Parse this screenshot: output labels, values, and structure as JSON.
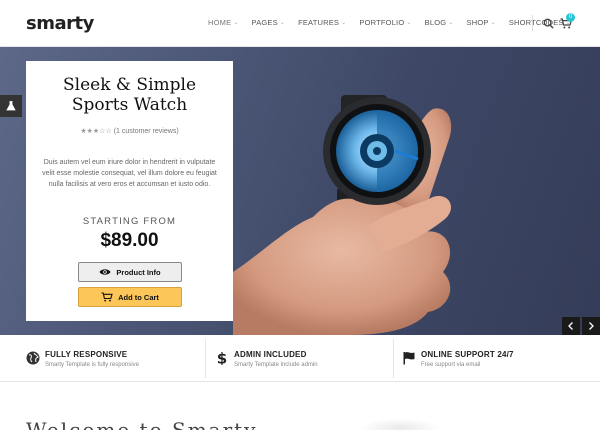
{
  "header": {
    "logo": "smarty",
    "nav": [
      {
        "label": "HOME",
        "dropdown": true,
        "active": true
      },
      {
        "label": "PAGES",
        "dropdown": true
      },
      {
        "label": "FEATURES",
        "dropdown": true
      },
      {
        "label": "PORTFOLIO",
        "dropdown": true
      },
      {
        "label": "BLOG",
        "dropdown": true
      },
      {
        "label": "SHOP",
        "dropdown": true
      },
      {
        "label": "SHORTCODES",
        "dropdown": true
      }
    ],
    "cart_count": "0",
    "icons": {
      "search": "search-icon",
      "cart": "cart-icon"
    }
  },
  "hero": {
    "title": "Sleek & Simple Sports Watch",
    "rating_stars": "★★★☆☆",
    "rating_text": "(1 customer reviews)",
    "description": "Duis autem vel eum iriure dolor in hendrerit in vulputate velit esse molestie consequat, vel illum dolore eu feugiat nulla facilisis at vero eros et accumsan et iusto odio.",
    "starting_label": "STARTING FROM",
    "price": "$89.00",
    "product_info_label": "Product Info",
    "add_to_cart_label": "Add to Cart",
    "accent_color": "#fdc659"
  },
  "features": [
    {
      "title": "FULLY RESPONSIVE",
      "desc": "Smarty Template is fully responsive",
      "icon": "globe-icon"
    },
    {
      "title": "ADMIN INCLUDED",
      "desc": "Smarty Template include admin",
      "icon": "dollar-icon"
    },
    {
      "title": "ONLINE SUPPORT 24/7",
      "desc": "Free support via email",
      "icon": "flag-icon"
    }
  ],
  "bottom": {
    "heading_partial": "Welcome to Smarty"
  }
}
